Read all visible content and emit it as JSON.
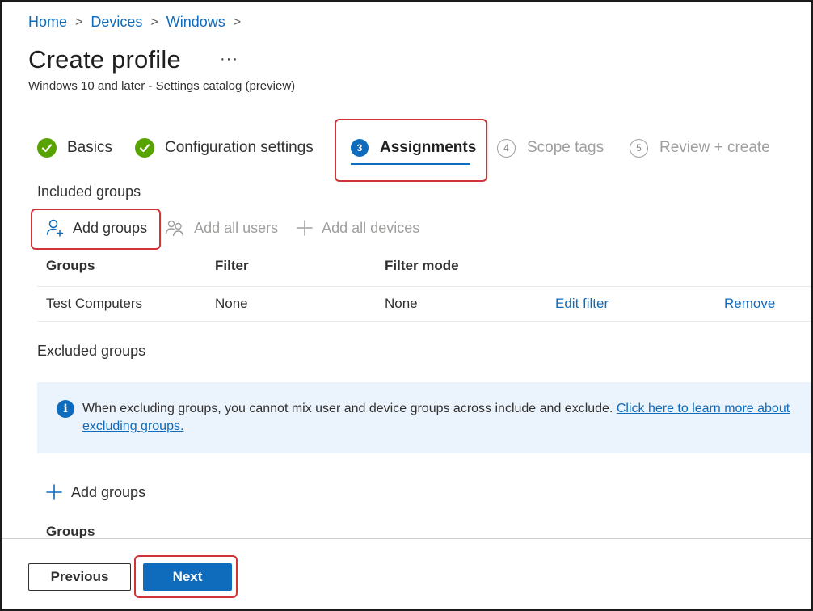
{
  "breadcrumb": {
    "items": [
      "Home",
      "Devices",
      "Windows"
    ],
    "separator": ">"
  },
  "header": {
    "title": "Create profile",
    "more": "···",
    "subtitle": "Windows 10 and later - Settings catalog (preview)"
  },
  "steps": [
    {
      "label": "Basics",
      "state": "done"
    },
    {
      "label": "Configuration settings",
      "state": "done"
    },
    {
      "number": "3",
      "label": "Assignments",
      "state": "active"
    },
    {
      "number": "4",
      "label": "Scope tags",
      "state": "inactive"
    },
    {
      "number": "5",
      "label": "Review + create",
      "state": "inactive"
    }
  ],
  "included": {
    "title": "Included groups",
    "toolbar": {
      "add_groups": "Add groups",
      "add_all_users": "Add all users",
      "add_all_devices": "Add all devices"
    },
    "table": {
      "headers": [
        "Groups",
        "Filter",
        "Filter mode"
      ],
      "rows": [
        {
          "group": "Test Computers",
          "filter": "None",
          "filter_mode": "None",
          "edit": "Edit filter",
          "remove": "Remove"
        }
      ]
    }
  },
  "excluded": {
    "title": "Excluded groups",
    "info": {
      "text": "When excluding groups, you cannot mix user and device groups across include and exclude. ",
      "link": "Click here to learn more about excluding groups."
    },
    "add_groups": "Add groups",
    "column_header": "Groups"
  },
  "footer": {
    "previous": "Previous",
    "next": "Next"
  },
  "colors": {
    "accent": "#0f6cbd",
    "success": "#57a300",
    "highlight": "#d13438",
    "info_background": "#ebf3fc"
  },
  "icons": {
    "step_done": "checkmark-circle-icon",
    "add_groups": "person-add-icon",
    "add_all_users": "people-icon",
    "add_all_devices": "plus-icon",
    "info": "info-icon"
  }
}
